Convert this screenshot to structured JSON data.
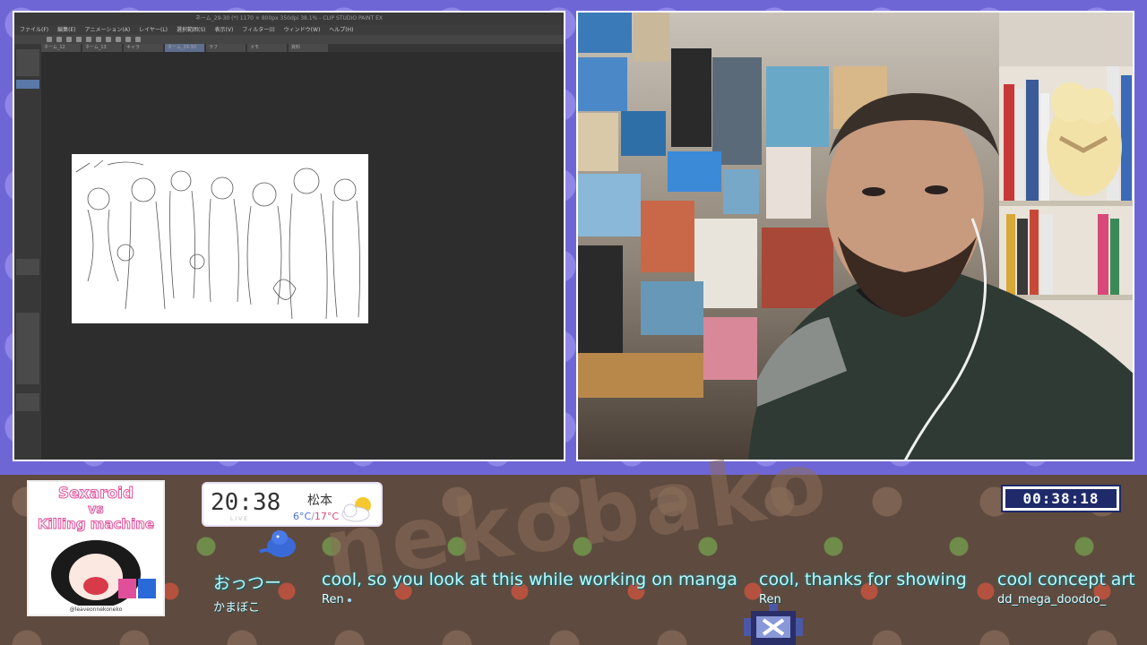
{
  "app": {
    "title": "ネーム_29-30 (*) 1170 × 800px 350dpi 38.1% - CLIP STUDIO PAINT EX",
    "menu": [
      "ファイル(F)",
      "編集(E)",
      "アニメーション(A)",
      "レイヤー(L)",
      "選択範囲(S)",
      "表示(V)",
      "フィルター(I)",
      "ウィンドウ(W)",
      "ヘルプ(H)"
    ],
    "tabs": [
      "ネーム_12",
      "ネーム_13",
      "キャラ",
      "ネーム_29-30",
      "ラフ",
      "メモ",
      "資料"
    ]
  },
  "overlay": {
    "cover": {
      "line1": "Sexaroid",
      "line2": "vs",
      "line3": "Killing machine",
      "credit": "@leaveonnekoneko"
    },
    "clock": {
      "time": "20:38",
      "sub": "LIVE",
      "city": "松本",
      "temp_low": "6°C",
      "temp_sep": "/",
      "temp_high": "17°C"
    },
    "timer": "00:38:18",
    "chat": [
      {
        "text": "おっつー",
        "user": "かまぼこ"
      },
      {
        "text": "cool, so you look at this while working on manga",
        "user": "Ren"
      },
      {
        "text": "cool, thanks for showing",
        "user": "Ren"
      },
      {
        "text": "cool concept art",
        "user": "dd_mega_doodoo_"
      }
    ],
    "deco": "nekobako"
  },
  "colors": {
    "background": "#6f66d6",
    "frame": "#ffffff",
    "chat_text": "#bff5f5",
    "timer_bg": "#1e2a6a"
  }
}
